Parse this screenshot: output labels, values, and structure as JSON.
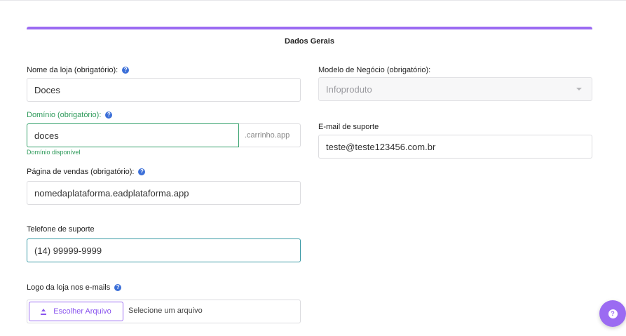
{
  "section": {
    "title": "Dados Gerais"
  },
  "store_name": {
    "label": "Nome da loja (obrigatório):",
    "value": "Doces"
  },
  "domain": {
    "label": "Domínio (obrigatório):",
    "value": "doces",
    "suffix": ".carrinho.app",
    "hint": "Domínio disponível"
  },
  "sales_page": {
    "label": "Página de vendas (obrigatório):",
    "value": "nomedaplataforma.eadplataforma.app"
  },
  "support_phone": {
    "label": "Telefone de suporte",
    "value": "(14) 99999-9999"
  },
  "logo": {
    "label": "Logo da loja nos e-mails",
    "button": "Escolher Arquivo",
    "placeholder": "Selecione um arquivo"
  },
  "business_model": {
    "label": "Modelo de Negócio (obrigatório):",
    "value": "Infoproduto"
  },
  "support_email": {
    "label": "E-mail de suporte",
    "value": "teste@teste123456.com.br"
  },
  "icons": {
    "help": "question-circle-icon",
    "upload": "upload-icon",
    "chat": "chat-bubble-icon",
    "caret": "caret-down-icon"
  },
  "colors": {
    "accent": "#9b6bf2",
    "success": "#2e9a5a",
    "help": "#3b6fd8"
  }
}
